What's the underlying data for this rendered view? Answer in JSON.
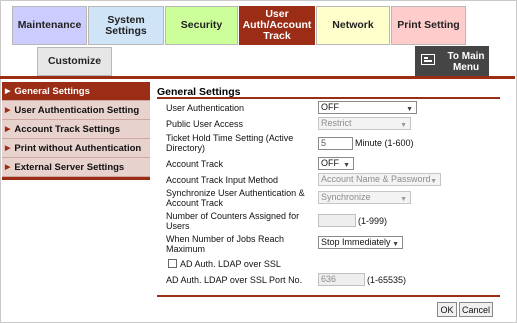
{
  "tabs": [
    {
      "label": "Maintenance",
      "bg": "#ccccff"
    },
    {
      "label": "System Settings",
      "bg": "#cfe4f7"
    },
    {
      "label": "Security",
      "bg": "#ccff99"
    },
    {
      "label": "User Auth/Account Track",
      "bg": "#9b2c16",
      "active": true
    },
    {
      "label": "Network",
      "bg": "#ffffcc"
    },
    {
      "label": "Print Setting",
      "bg": "#ffcccc"
    },
    {
      "label": "Customize",
      "bg": "#e6e6e6"
    }
  ],
  "to_main_menu": "To Main Menu",
  "sidebar": {
    "items": [
      {
        "label": "General Settings",
        "active": true
      },
      {
        "label": "User Authentication Setting"
      },
      {
        "label": "Account Track Settings"
      },
      {
        "label": "Print without Authentication"
      },
      {
        "label": "External Server Settings"
      }
    ]
  },
  "main": {
    "title": "General Settings",
    "user_authentication": {
      "label": "User Authentication",
      "value": "OFF"
    },
    "public_user_access": {
      "label": "Public User Access",
      "value": "Restrict"
    },
    "ticket_hold_time": {
      "label": "Ticket Hold Time Setting (Active Directory)",
      "value": "5",
      "unit": "Minute (1-600)"
    },
    "account_track": {
      "label": "Account Track",
      "value": "OFF"
    },
    "account_track_input_method": {
      "label": "Account Track Input Method",
      "value": "Account Name & Password"
    },
    "synchronize": {
      "label": "Synchronize User Authentication & Account Track",
      "value": "Synchronize"
    },
    "num_counters": {
      "label": "Number of Counters Assigned for Users",
      "value": "",
      "unit": "(1-999)"
    },
    "jobs_reach_max": {
      "label": "When Number of Jobs Reach Maximum",
      "value": "Stop Immediately"
    },
    "ad_ldap_ssl": {
      "label": "AD Auth. LDAP over SSL",
      "checked": false
    },
    "ad_ldap_port": {
      "label": "AD Auth. LDAP over SSL Port No.",
      "value": "636",
      "unit": "(1-65535)"
    }
  },
  "buttons": {
    "ok": "OK",
    "cancel": "Cancel"
  },
  "colors": {
    "accent": "#9b2c16",
    "sidebar_bg": "#e7d2cd",
    "menu_button": "#454545"
  }
}
